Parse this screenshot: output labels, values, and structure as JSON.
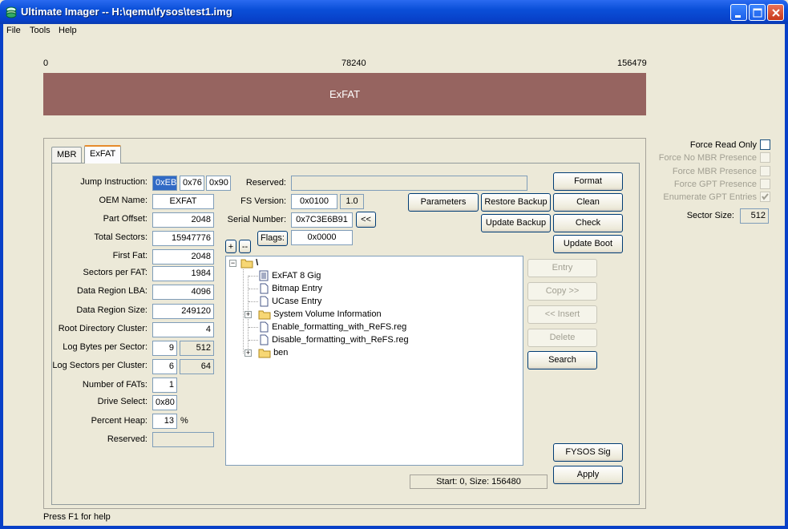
{
  "window": {
    "title": "Ultimate Imager -- H:\\qemu\\fysos\\test1.img"
  },
  "menu": [
    "File",
    "Tools",
    "Help"
  ],
  "partition_map": {
    "start": "0",
    "middle": "78240",
    "end": "156479",
    "label": "ExFAT",
    "color": "#966460"
  },
  "tabs": [
    "MBR",
    "ExFAT"
  ],
  "form": {
    "jump_label": "Jump Instruction:",
    "jump": [
      "0xEB",
      "0x76",
      "0x90"
    ],
    "oem_label": "OEM Name:",
    "oem": "EXFAT",
    "part_offset_label": "Part Offset:",
    "part_offset": "2048",
    "total_sectors_label": "Total Sectors:",
    "total_sectors": "15947776",
    "first_fat_label": "First Fat:",
    "first_fat": "2048",
    "sectors_per_fat_label": "Sectors per FAT:",
    "sectors_per_fat": "1984",
    "data_lba_label": "Data Region LBA:",
    "data_lba": "4096",
    "data_size_label": "Data Region Size:",
    "data_size": "249120",
    "root_cluster_label": "Root Directory Cluster:",
    "root_cluster": "4",
    "log_bps_label": "Log Bytes per Sector:",
    "log_bps": "9",
    "bps": "512",
    "log_spc_label": "Log Sectors per Cluster:",
    "log_spc": "6",
    "spc": "64",
    "num_fats_label": "Number of FATs:",
    "num_fats": "1",
    "drive_select_label": "Drive Select:",
    "drive_select": "0x80",
    "percent_heap_label": "Percent Heap:",
    "percent_heap": "13",
    "percent_sign": "%",
    "reserved_label": "Reserved:",
    "reserved": "",
    "reserved2_label": "Reserved:",
    "reserved2": "",
    "fs_version_label": "FS Version:",
    "fs_version": "0x0100",
    "fs_version_dec": "1.0",
    "serial_label": "Serial Number:",
    "serial": "0x7C3E6B91",
    "serial_btn": "<<",
    "flags_btn": "Flags:",
    "flags": "0x0000"
  },
  "buttons": {
    "parameters": "Parameters",
    "restore_backup": "Restore Backup",
    "update_backup": "Update Backup",
    "format": "Format",
    "clean": "Clean",
    "check": "Check",
    "update_boot": "Update Boot",
    "entry": "Entry",
    "copy": "Copy >>",
    "insert": "<< Insert",
    "delete": "Delete",
    "search": "Search",
    "fysos_sig": "FYSOS Sig",
    "apply": "Apply",
    "expand": "+",
    "collapse": "--"
  },
  "tree": {
    "root": "\\",
    "items": [
      {
        "name": "ExFAT 8 Gig",
        "icon": "doc-lines-icon"
      },
      {
        "name": "Bitmap Entry",
        "icon": "doc-icon"
      },
      {
        "name": "UCase Entry",
        "icon": "doc-icon"
      },
      {
        "name": "System Volume Information",
        "icon": "folder-icon"
      },
      {
        "name": "Enable_formatting_with_ReFS.reg",
        "icon": "doc-icon"
      },
      {
        "name": "Disable_formatting_with_ReFS.reg",
        "icon": "doc-icon"
      },
      {
        "name": "ben",
        "icon": "folder-icon"
      }
    ]
  },
  "status_info": "Start: 0, Size: 156480",
  "options": {
    "force_read_only": "Force Read Only",
    "force_no_mbr": "Force No MBR Presence",
    "force_mbr": "Force MBR Presence",
    "force_gpt": "Force GPT Presence",
    "enumerate_gpt": "Enumerate GPT Entries",
    "sector_size_label": "Sector Size:",
    "sector_size": "512"
  },
  "statusbar": "Press F1 for help"
}
